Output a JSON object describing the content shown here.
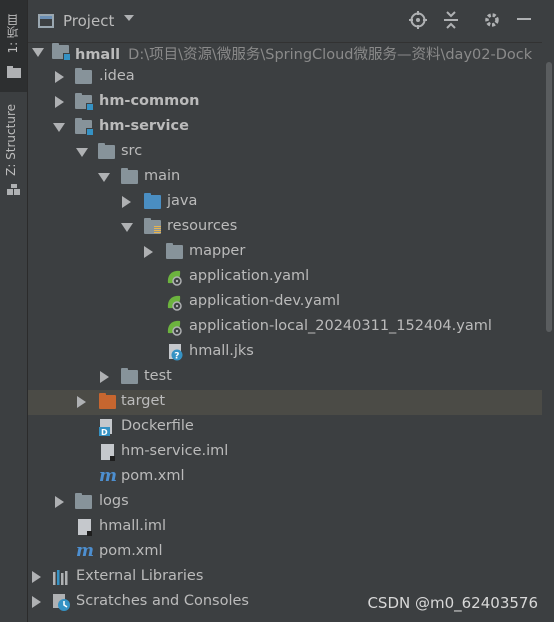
{
  "side_strip": {
    "tabs": [
      {
        "label": "1: 项目"
      },
      {
        "label": "Z: Structure"
      }
    ]
  },
  "header": {
    "title": "Project"
  },
  "tree": [
    {
      "label": "hmall",
      "path": "D:\\项目\\资源\\微服务\\SpringCloud微服务—资料\\day02-Dock",
      "icon": "module-folder-icon"
    },
    {
      "label": ".idea",
      "icon": "folder-icon"
    },
    {
      "label": "hm-common",
      "icon": "module-folder-icon"
    },
    {
      "label": "hm-service",
      "icon": "module-folder-icon"
    },
    {
      "label": "src",
      "icon": "folder-icon"
    },
    {
      "label": "main",
      "icon": "folder-icon"
    },
    {
      "label": "java",
      "icon": "source-folder-icon"
    },
    {
      "label": "resources",
      "icon": "resources-folder-icon"
    },
    {
      "label": "mapper",
      "icon": "folder-icon"
    },
    {
      "label": "application.yaml",
      "icon": "spring-config-icon"
    },
    {
      "label": "application-dev.yaml",
      "icon": "spring-config-icon"
    },
    {
      "label": "application-local_20240311_152404.yaml",
      "icon": "spring-config-icon"
    },
    {
      "label": "hmall.jks",
      "icon": "unknown-file-icon"
    },
    {
      "label": "test",
      "icon": "folder-icon"
    },
    {
      "label": "target",
      "icon": "excluded-folder-icon"
    },
    {
      "label": "Dockerfile",
      "icon": "docker-icon"
    },
    {
      "label": "hm-service.iml",
      "icon": "iml-file-icon"
    },
    {
      "label": "pom.xml",
      "icon": "maven-icon"
    },
    {
      "label": "logs",
      "icon": "folder-icon"
    },
    {
      "label": "hmall.iml",
      "icon": "iml-file-icon"
    },
    {
      "label": "pom.xml",
      "icon": "maven-icon"
    },
    {
      "label": "External Libraries",
      "icon": "libraries-icon"
    },
    {
      "label": "Scratches and Consoles",
      "icon": "scratches-icon"
    }
  ],
  "watermark": "CSDN @m0_62403576",
  "colors": {
    "background": "#3c3f41",
    "selected_row": "#4b4b46",
    "folder": "#87939a",
    "source_folder": "#4a8ec2",
    "excluded_folder": "#c7662f",
    "maven": "#4d8fd0",
    "spring": "#6cb33e"
  }
}
